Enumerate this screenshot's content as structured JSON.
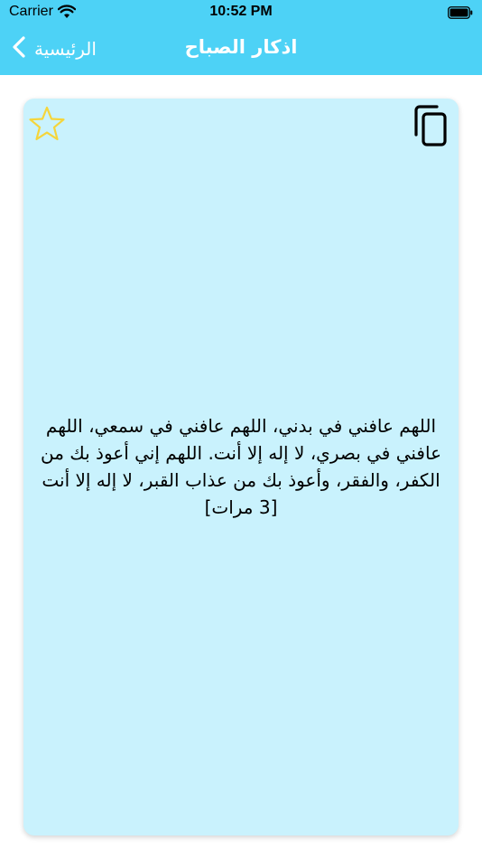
{
  "status_bar": {
    "carrier": "Carrier",
    "time": "10:52 PM",
    "wifi_icon": "wifi-icon",
    "battery_icon": "battery-full-icon"
  },
  "nav": {
    "back_label": "الرئيسية",
    "back_icon": "chevron-left-icon",
    "title": "اذكار الصباح",
    "background_color": "#4dd2f6"
  },
  "card": {
    "background_color": "#c9f2fd",
    "favorite_icon": "star-outline-icon",
    "favorite_color": "#f5d53b",
    "copy_icon": "copy-icon",
    "text": "اللهم عافني في بدني، اللهم عافني في سمعي، اللهم عافني في بصري، لا إله إلا أنت. اللهم إني أعوذ بك من الكفر، والفقر، وأعوذ بك من عذاب القبر، لا إله إلا أنت [3 مرات]"
  }
}
